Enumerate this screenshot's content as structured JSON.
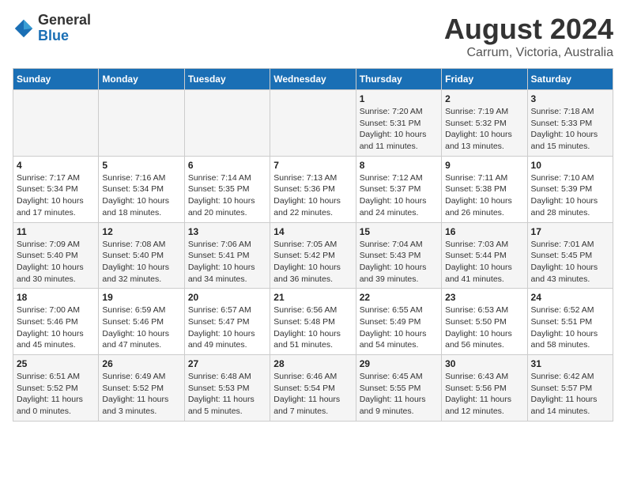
{
  "logo": {
    "general": "General",
    "blue": "Blue"
  },
  "title": "August 2024",
  "subtitle": "Carrum, Victoria, Australia",
  "days_of_week": [
    "Sunday",
    "Monday",
    "Tuesday",
    "Wednesday",
    "Thursday",
    "Friday",
    "Saturday"
  ],
  "weeks": [
    [
      {
        "day": "",
        "info": ""
      },
      {
        "day": "",
        "info": ""
      },
      {
        "day": "",
        "info": ""
      },
      {
        "day": "",
        "info": ""
      },
      {
        "day": "1",
        "info": "Sunrise: 7:20 AM\nSunset: 5:31 PM\nDaylight: 10 hours\nand 11 minutes."
      },
      {
        "day": "2",
        "info": "Sunrise: 7:19 AM\nSunset: 5:32 PM\nDaylight: 10 hours\nand 13 minutes."
      },
      {
        "day": "3",
        "info": "Sunrise: 7:18 AM\nSunset: 5:33 PM\nDaylight: 10 hours\nand 15 minutes."
      }
    ],
    [
      {
        "day": "4",
        "info": "Sunrise: 7:17 AM\nSunset: 5:34 PM\nDaylight: 10 hours\nand 17 minutes."
      },
      {
        "day": "5",
        "info": "Sunrise: 7:16 AM\nSunset: 5:34 PM\nDaylight: 10 hours\nand 18 minutes."
      },
      {
        "day": "6",
        "info": "Sunrise: 7:14 AM\nSunset: 5:35 PM\nDaylight: 10 hours\nand 20 minutes."
      },
      {
        "day": "7",
        "info": "Sunrise: 7:13 AM\nSunset: 5:36 PM\nDaylight: 10 hours\nand 22 minutes."
      },
      {
        "day": "8",
        "info": "Sunrise: 7:12 AM\nSunset: 5:37 PM\nDaylight: 10 hours\nand 24 minutes."
      },
      {
        "day": "9",
        "info": "Sunrise: 7:11 AM\nSunset: 5:38 PM\nDaylight: 10 hours\nand 26 minutes."
      },
      {
        "day": "10",
        "info": "Sunrise: 7:10 AM\nSunset: 5:39 PM\nDaylight: 10 hours\nand 28 minutes."
      }
    ],
    [
      {
        "day": "11",
        "info": "Sunrise: 7:09 AM\nSunset: 5:40 PM\nDaylight: 10 hours\nand 30 minutes."
      },
      {
        "day": "12",
        "info": "Sunrise: 7:08 AM\nSunset: 5:40 PM\nDaylight: 10 hours\nand 32 minutes."
      },
      {
        "day": "13",
        "info": "Sunrise: 7:06 AM\nSunset: 5:41 PM\nDaylight: 10 hours\nand 34 minutes."
      },
      {
        "day": "14",
        "info": "Sunrise: 7:05 AM\nSunset: 5:42 PM\nDaylight: 10 hours\nand 36 minutes."
      },
      {
        "day": "15",
        "info": "Sunrise: 7:04 AM\nSunset: 5:43 PM\nDaylight: 10 hours\nand 39 minutes."
      },
      {
        "day": "16",
        "info": "Sunrise: 7:03 AM\nSunset: 5:44 PM\nDaylight: 10 hours\nand 41 minutes."
      },
      {
        "day": "17",
        "info": "Sunrise: 7:01 AM\nSunset: 5:45 PM\nDaylight: 10 hours\nand 43 minutes."
      }
    ],
    [
      {
        "day": "18",
        "info": "Sunrise: 7:00 AM\nSunset: 5:46 PM\nDaylight: 10 hours\nand 45 minutes."
      },
      {
        "day": "19",
        "info": "Sunrise: 6:59 AM\nSunset: 5:46 PM\nDaylight: 10 hours\nand 47 minutes."
      },
      {
        "day": "20",
        "info": "Sunrise: 6:57 AM\nSunset: 5:47 PM\nDaylight: 10 hours\nand 49 minutes."
      },
      {
        "day": "21",
        "info": "Sunrise: 6:56 AM\nSunset: 5:48 PM\nDaylight: 10 hours\nand 51 minutes."
      },
      {
        "day": "22",
        "info": "Sunrise: 6:55 AM\nSunset: 5:49 PM\nDaylight: 10 hours\nand 54 minutes."
      },
      {
        "day": "23",
        "info": "Sunrise: 6:53 AM\nSunset: 5:50 PM\nDaylight: 10 hours\nand 56 minutes."
      },
      {
        "day": "24",
        "info": "Sunrise: 6:52 AM\nSunset: 5:51 PM\nDaylight: 10 hours\nand 58 minutes."
      }
    ],
    [
      {
        "day": "25",
        "info": "Sunrise: 6:51 AM\nSunset: 5:52 PM\nDaylight: 11 hours\nand 0 minutes."
      },
      {
        "day": "26",
        "info": "Sunrise: 6:49 AM\nSunset: 5:52 PM\nDaylight: 11 hours\nand 3 minutes."
      },
      {
        "day": "27",
        "info": "Sunrise: 6:48 AM\nSunset: 5:53 PM\nDaylight: 11 hours\nand 5 minutes."
      },
      {
        "day": "28",
        "info": "Sunrise: 6:46 AM\nSunset: 5:54 PM\nDaylight: 11 hours\nand 7 minutes."
      },
      {
        "day": "29",
        "info": "Sunrise: 6:45 AM\nSunset: 5:55 PM\nDaylight: 11 hours\nand 9 minutes."
      },
      {
        "day": "30",
        "info": "Sunrise: 6:43 AM\nSunset: 5:56 PM\nDaylight: 11 hours\nand 12 minutes."
      },
      {
        "day": "31",
        "info": "Sunrise: 6:42 AM\nSunset: 5:57 PM\nDaylight: 11 hours\nand 14 minutes."
      }
    ]
  ]
}
